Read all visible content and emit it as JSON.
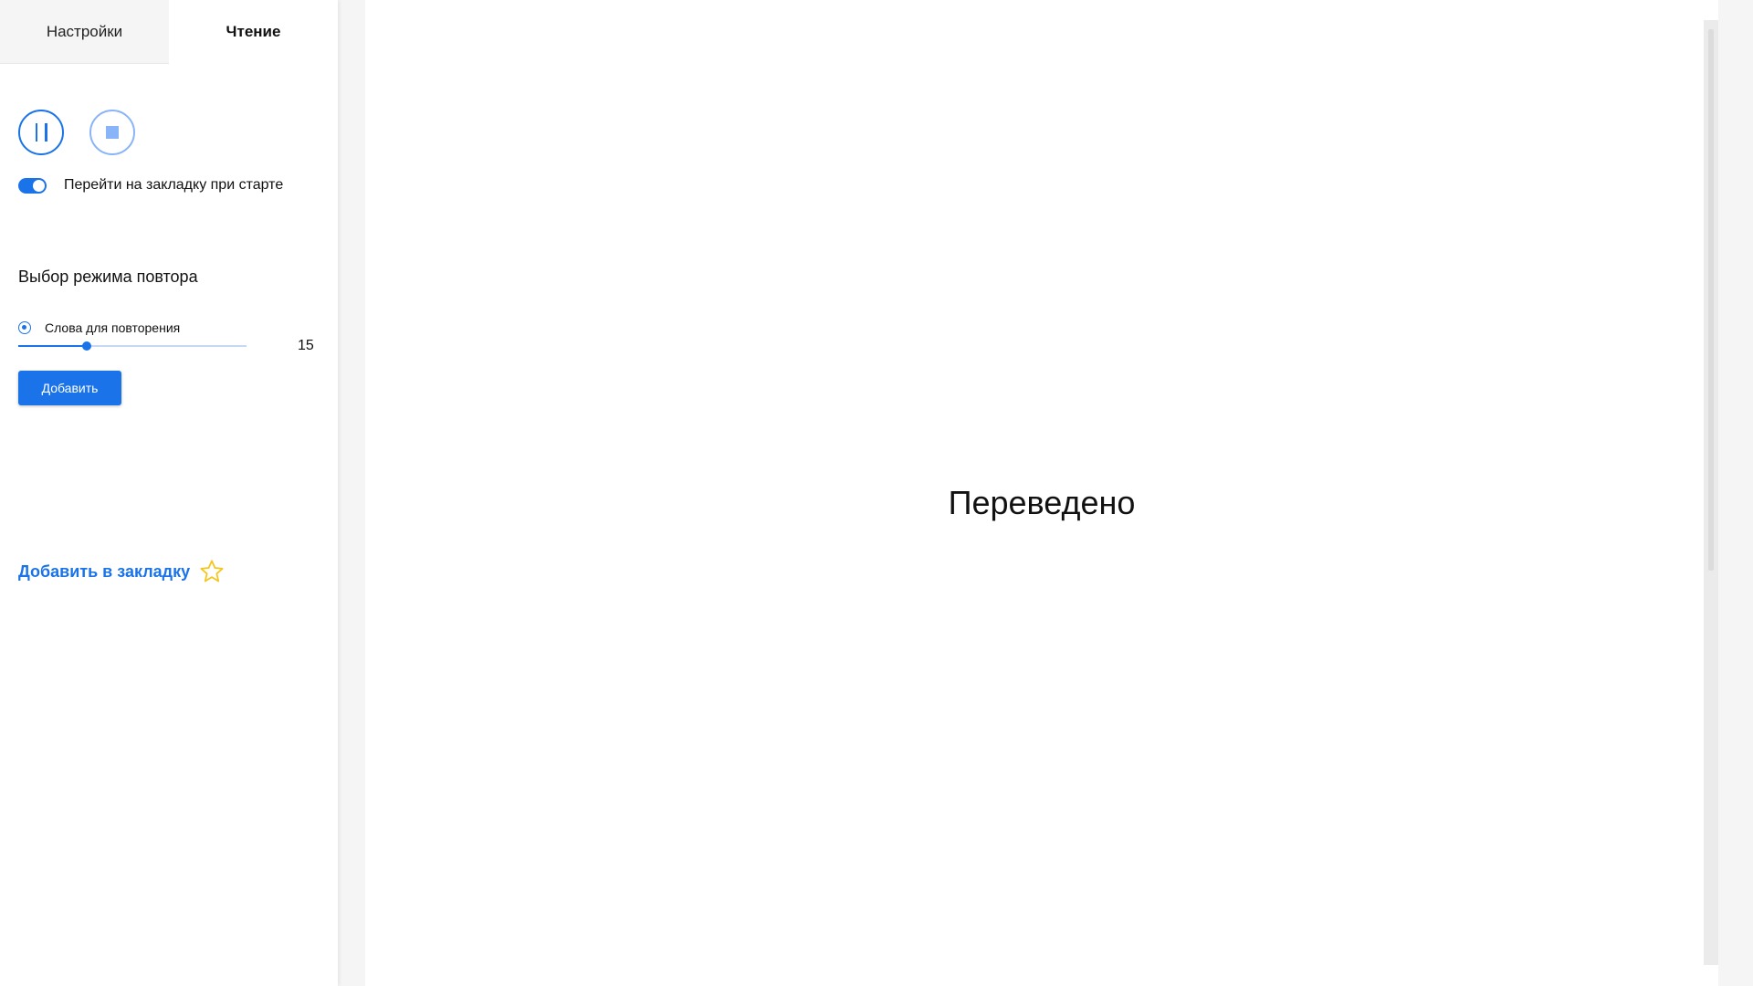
{
  "tabs": [
    {
      "label": "Настройки",
      "active": false
    },
    {
      "label": "Чтение",
      "active": true
    }
  ],
  "controls": {
    "pause_icon": "pause-icon",
    "stop_icon": "stop-icon"
  },
  "toggle": {
    "label": "Перейти на закладку при старте",
    "on": true
  },
  "repeat": {
    "title": "Выбор режима повтора",
    "radio_label": "Слова для повторения",
    "slider_value": "15",
    "slider_fraction": 0.3,
    "add_button": "Добавить"
  },
  "bookmark": {
    "label": "Добавить в закладку",
    "icon": "star-icon"
  },
  "main": {
    "text": "Переведено"
  },
  "colors": {
    "accent": "#1a73e8",
    "accent_light": "#8ab4f8",
    "star": "#f5c518"
  }
}
